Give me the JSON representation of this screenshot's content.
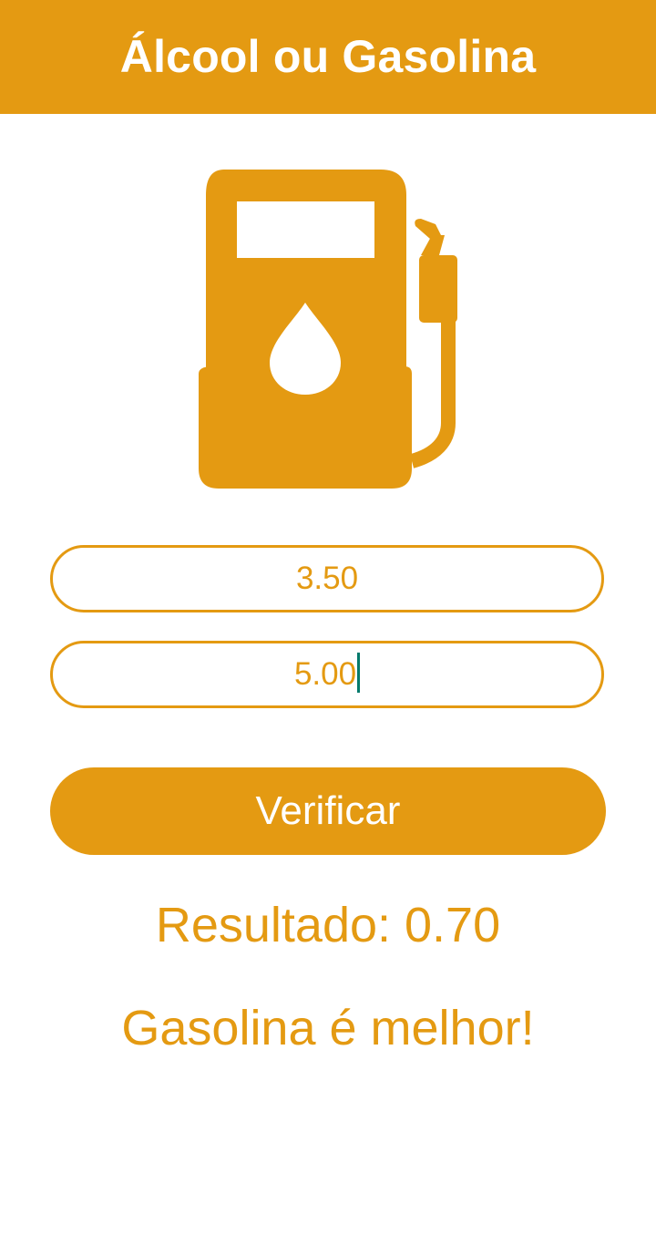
{
  "app_bar": {
    "title": "Álcool ou Gasolina",
    "color": "#e49a12"
  },
  "icon": {
    "name": "gas-pump-icon",
    "color": "#e49a12"
  },
  "inputs": {
    "alcohol_price": "3.50",
    "gasoline_price": "5.00"
  },
  "button": {
    "label": "Verificar"
  },
  "result": {
    "value_text": "Resultado: 0.70",
    "message": "Gasolina é melhor!"
  }
}
